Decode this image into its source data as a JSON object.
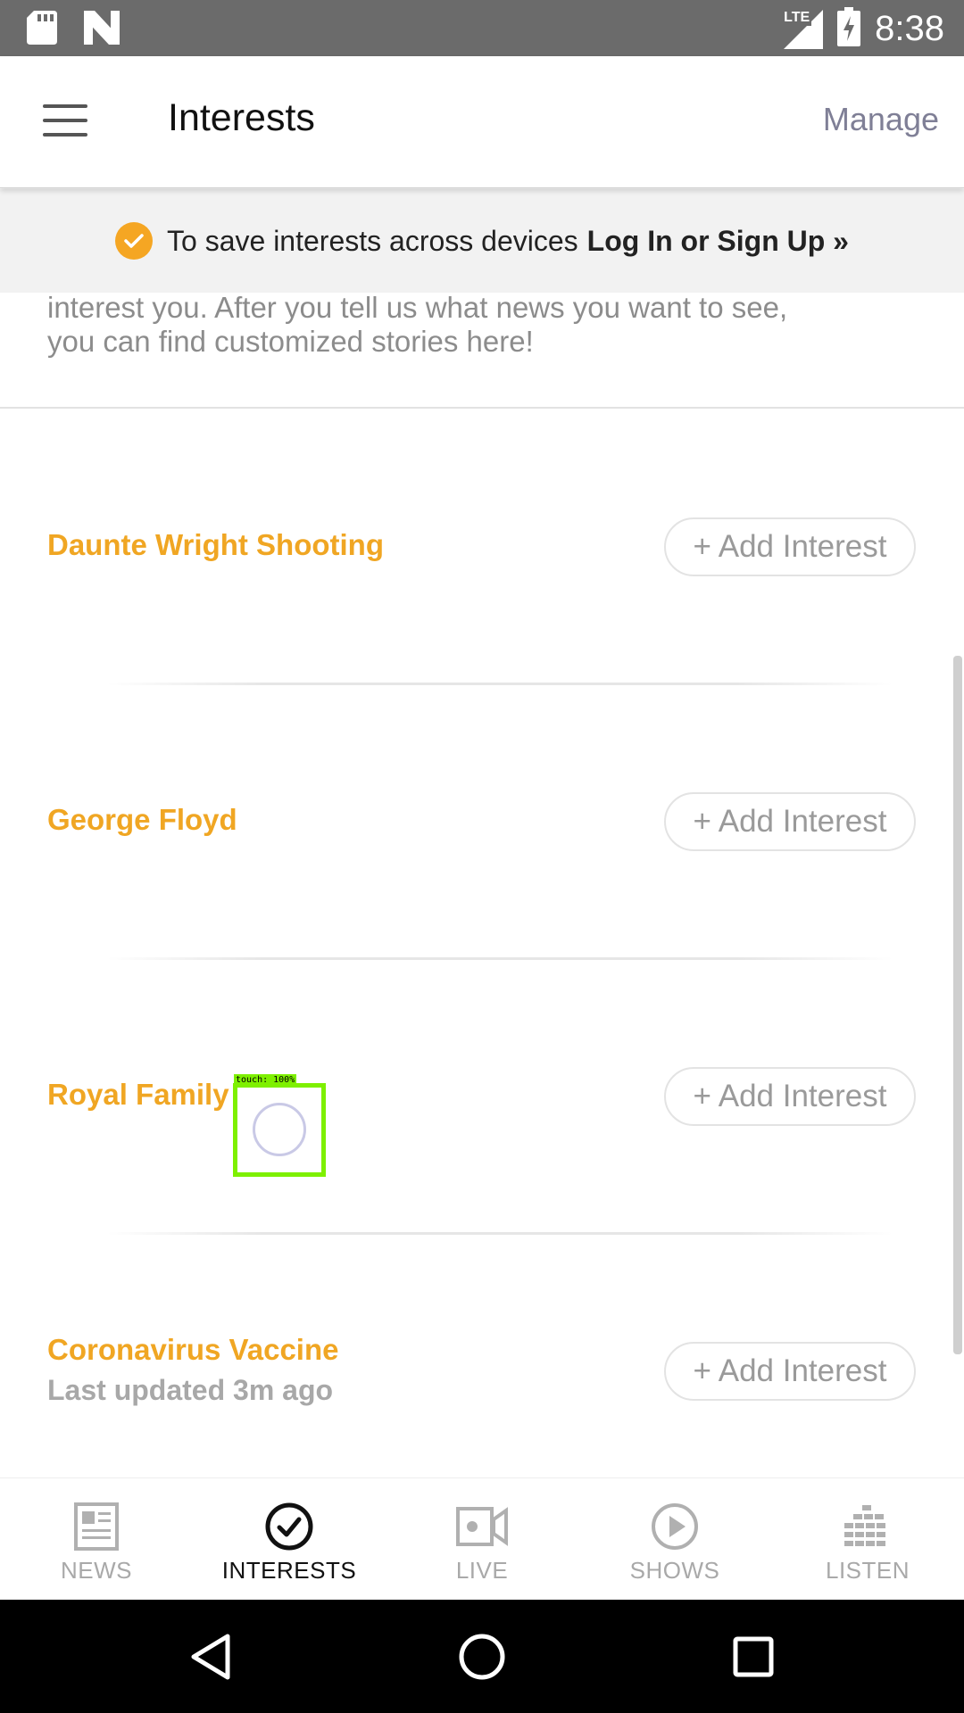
{
  "status_bar": {
    "time": "8:38",
    "network": "LTE",
    "icons": [
      "sd-card-icon",
      "n-app-icon",
      "signal-icon",
      "battery-charging-icon"
    ]
  },
  "header": {
    "title": "Interests",
    "manage_label": "Manage",
    "menu_icon": "hamburger-menu-icon"
  },
  "banner": {
    "text": "To save interests across devices",
    "link": "Log In or Sign Up »",
    "accent_color": "#f5a623"
  },
  "intro": {
    "line2": "interest you. After you tell us what news you want to see,",
    "line3": "you can find customized stories here!"
  },
  "interests": [
    {
      "topic": "Daunte Wright Shooting",
      "button": "+ Add Interest"
    },
    {
      "topic": "George Floyd",
      "button": "+ Add Interest"
    },
    {
      "topic": "Royal Family",
      "button": "+ Add Interest"
    },
    {
      "topic": "Coronavirus Vaccine",
      "updated": "Last updated 3m ago",
      "button": "+ Add Interest"
    }
  ],
  "touch_overlay": {
    "label": "touch: 100%"
  },
  "tabs": [
    {
      "label": "NEWS",
      "icon": "newspaper-icon",
      "active": false
    },
    {
      "label": "INTERESTS",
      "icon": "check-circle-icon",
      "active": true
    },
    {
      "label": "LIVE",
      "icon": "video-camera-icon",
      "active": false
    },
    {
      "label": "SHOWS",
      "icon": "play-circle-icon",
      "active": false
    },
    {
      "label": "LISTEN",
      "icon": "equalizer-icon",
      "active": false
    }
  ],
  "colors": {
    "topic": "#f0a623",
    "status_bar": "#6b6b6b",
    "manage": "#7f7f96"
  }
}
